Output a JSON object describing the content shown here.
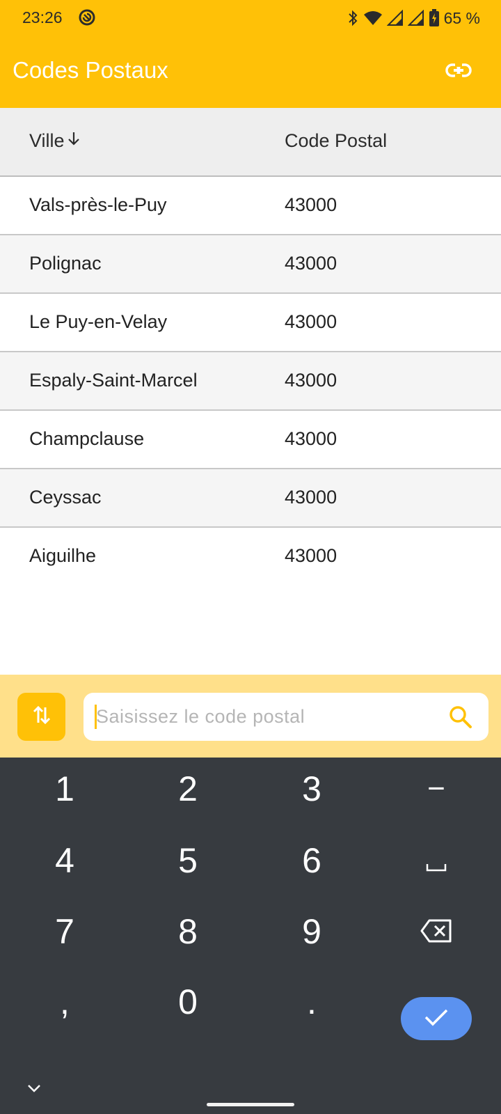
{
  "status_bar": {
    "time": "23:26",
    "battery": "65 %",
    "icons": [
      "app-notification-icon",
      "bluetooth-icon",
      "wifi-icon",
      "signal-icon",
      "signal-icon",
      "battery-charging-icon"
    ]
  },
  "app_bar": {
    "title": "Codes Postaux",
    "action_icon": "link-icon"
  },
  "table": {
    "columns": [
      "Ville",
      "Code Postal"
    ],
    "sort_icon": "arrow-down-icon",
    "rows": [
      {
        "city": "Vals-près-le-Puy",
        "code": "43000"
      },
      {
        "city": "Polignac",
        "code": "43000"
      },
      {
        "city": "Le Puy-en-Velay",
        "code": "43000"
      },
      {
        "city": "Espaly-Saint-Marcel",
        "code": "43000"
      },
      {
        "city": "Champclause",
        "code": "43000"
      },
      {
        "city": "Ceyssac",
        "code": "43000"
      },
      {
        "city": "Aiguilhe",
        "code": "43000"
      }
    ]
  },
  "search": {
    "placeholder": "Saisissez le code postal",
    "value": "",
    "swap_icon": "swap-vertical-icon",
    "search_icon": "search-icon"
  },
  "keyboard": {
    "keys": [
      "1",
      "2",
      "3",
      "−",
      "4",
      "5",
      "6",
      "␣",
      "7",
      "8",
      "9",
      "⌫",
      ",",
      "0",
      ".",
      "✓"
    ]
  },
  "colors": {
    "primary": "#ffc107",
    "search_bar_bg": "#ffe08a",
    "keyboard_bg": "#373b40",
    "enter_key": "#5b92f0"
  }
}
